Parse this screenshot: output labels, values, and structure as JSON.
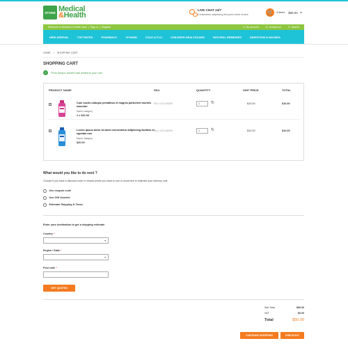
{
  "header": {
    "logo_badge": "STORE",
    "logo_line1": "Medical",
    "logo_amp": "&",
    "logo_line2": "Health",
    "live_chat_title": "LIVE CHAT 24/7",
    "live_chat_sub": "Consectetur adipiscing elit purus tortor ornare",
    "cart_items": "3 items",
    "cart_total": "$65.00"
  },
  "topbar": {
    "welcome": "Welcome to Medical & Health store",
    "signin": "Sign in",
    "register": "Register",
    "my_account": "My account",
    "contact_us": "Contact us",
    "search": "Search"
  },
  "nav": [
    "NEW ARRIVAL",
    "TOP RATED",
    "PHARMACY",
    "VITAMIN",
    "COLD & FLU",
    "CHILDREN HEALTHCARE",
    "NATURAL REMEDIES",
    "DIGESTION & NAUSEA"
  ],
  "breadcrumb": {
    "home": "HOME",
    "current": "SHOPPING CART"
  },
  "page_title": "SHOPPING CART",
  "success_msg": "Proin tempor laoreet was added to your cart",
  "table": {
    "headers": {
      "product": "PRODUCT NAME",
      "sku": "SKU",
      "quantity": "QUANTITY",
      "unit_price": "UNIT PRICE",
      "total": "TOTAL"
    },
    "rows": [
      {
        "name": "Cum sociis natoque penatibus et magnis parturient montes nascetur",
        "category": "Name category",
        "price_line": "2 x $20.00",
        "sku": "SKU: 0123 456789",
        "qty": "1",
        "unit_price": "$10.00",
        "total": "$10.00"
      },
      {
        "name": "Lorem ipsum dolor sit amet consectetur adipiscing facilisis et egestas non",
        "category": "Name category",
        "price_line": "$20.00",
        "sku": "SKU: 0123 456789",
        "qty": "1",
        "unit_price": "$10.00",
        "total": "$10.00"
      }
    ]
  },
  "next": {
    "title": "What would you like to do next ?",
    "desc": "Choose if you have a discount code or reward points you want to use or would like to estimate your delivery cost.",
    "options": [
      "Use coupon code",
      "Use Gift Voucher",
      "Estimate Shipping & Taxes"
    ]
  },
  "shipping": {
    "title": "Enter your destination to get a shipping estimate",
    "country_label": "Country",
    "region_label": "Region / State",
    "postcode_label": "Post code",
    "req_mark": "*",
    "get_quotes": "GET QUOTES"
  },
  "totals": {
    "subtotal_label": "Sub Total",
    "subtotal": "$50.00",
    "vat_label": "VAT",
    "vat": "$0.00",
    "total_label": "Total",
    "total": "$50.00"
  },
  "buttons": {
    "continue": "CONTINUE SHOPPING",
    "checkout": "CHECKOUT"
  },
  "colors": {
    "accent_blue": "#1ec3d8",
    "green": "#8dc63f",
    "brand_green": "#3fa34a",
    "orange": "#f47b20"
  }
}
